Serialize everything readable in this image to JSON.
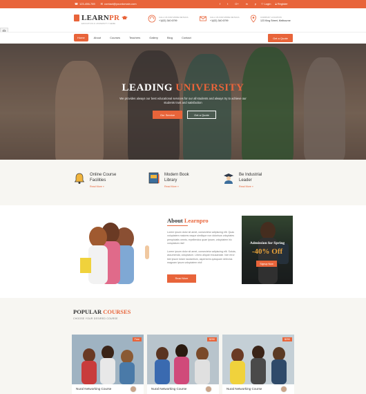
{
  "topbar": {
    "phone": "123-456-789",
    "email": "contact@yourdomain.com",
    "social": [
      "f",
      "t",
      "G+",
      "in",
      "p"
    ],
    "login": "Login",
    "register": "Register"
  },
  "header": {
    "logo_main": "LEARN",
    "logo_accent": "PR",
    "logo_tagline": "EDUCATION & UNIVERSITY THEME",
    "info": [
      {
        "label": "CALL US FOR MORE DETAILS",
        "value": "+1(02) 340 6799"
      },
      {
        "label": "CALL US FOR MORE DETAILS",
        "value": "+1(02) 340 6799"
      },
      {
        "label": "COMPANY LOCATION",
        "value": "123 King Street, Melbourne"
      }
    ]
  },
  "nav": {
    "items": [
      "Home",
      "About",
      "Courses",
      "Teachers",
      "Gallery",
      "Blog",
      "Contact"
    ],
    "quote": "Get a Quote"
  },
  "hero": {
    "title_main": "LEADING",
    "title_accent": "UNIVERSITY",
    "subtitle": "We provides always our best educational services for our all students and always try to achieve our students trust and satisfaction",
    "btn_primary": "Our Service",
    "btn_secondary": "Get a Quote"
  },
  "features": [
    {
      "title": "Online Course Facilities",
      "more": "Read More »"
    },
    {
      "title": "Modern Book Library",
      "more": "Read More »"
    },
    {
      "title": "Be Industrial Leader",
      "more": "Read More »"
    }
  ],
  "about": {
    "title_main": "About",
    "title_accent": "Learnpro",
    "p1": "Lorem ipsum dolor sit amet, consectetur adipiscing elit. Quas voluptatem maiores eaque similique non dolorisos voluptates perspiciatis omnis, repellendus quae ipsam, voluptatem hic voluptatum nisi!",
    "p2": "Lorem ipsum dolor sit amet, consectetur adipiscing elit. Soluta, assumenda, voluptatum. Libero aliquid recusandae. Iste error iste ipsum totam laudantium, asperiores quisquam delectus magnam ipsum voluptatem nisi!",
    "button": "Read More",
    "promo_title": "Admission for Spring",
    "promo_off": "-40% Off",
    "promo_btn": "Signup Now"
  },
  "courses": {
    "title_main": "POPULAR",
    "title_accent": "COURSES",
    "subtitle": "CHOOSE YOUR DESIRED COURSE",
    "items": [
      {
        "name": "Nural Networking Course",
        "price": "Free"
      },
      {
        "name": "Nural Networking Course",
        "price": "$290"
      },
      {
        "name": "Nural Networking Course",
        "price": "$290"
      }
    ]
  }
}
